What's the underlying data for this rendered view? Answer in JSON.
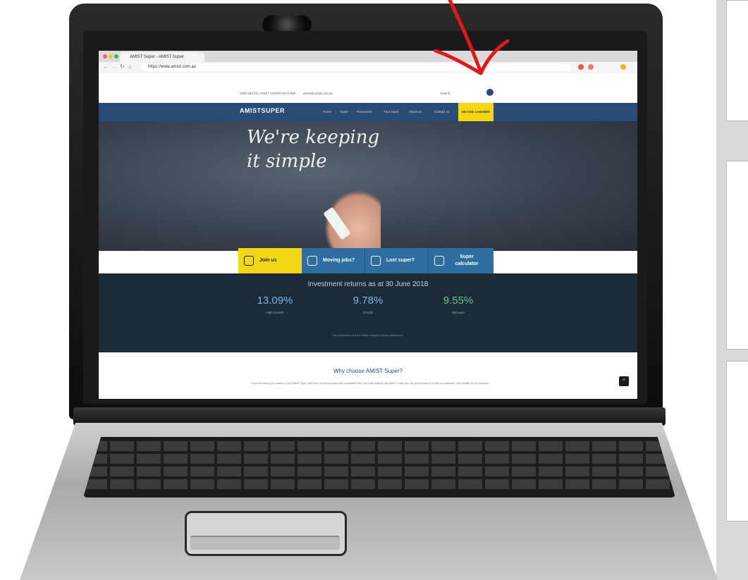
{
  "browser": {
    "tab_title": "AMIST Super - AMIST Super",
    "url": "https://www.amist.com.au"
  },
  "site": {
    "logo_text": "AMISTSUPER",
    "phone_text": "1300 653 911 AMIST SUPER HOTLINE",
    "email_text": "amist@amist.com.au",
    "search_placeholder": "Search",
    "nav_items": [
      "Home",
      "Super",
      "Resources",
      "Your super",
      "About us",
      "Contact us"
    ],
    "join_nav_label": "BECOME A MEMBER",
    "hero_headline_line1": "We're keeping",
    "hero_headline_line2": "it simple",
    "actions": [
      {
        "label": "Join us",
        "icon": "handshake-icon",
        "bg": "#f3d614",
        "fg": "#1c1c1c"
      },
      {
        "label": "Moving jobs?",
        "icon": "arrows-icon",
        "bg": "#2d6ea3",
        "fg": "#ffffff"
      },
      {
        "label": "Lost super?",
        "icon": "search-icon",
        "bg": "#2d6ea3",
        "fg": "#ffffff"
      },
      {
        "label": "Super calculator",
        "icon": "calculator-icon",
        "bg": "#2d6ea3",
        "fg": "#ffffff"
      }
    ],
    "returns_title": "Investment returns as at 30 June 2018",
    "returns": [
      {
        "value": "13.09%",
        "label": "High Growth",
        "color": "#6fb8e6"
      },
      {
        "value": "9.78%",
        "label": "Growth",
        "color": "#6fb8e6"
      },
      {
        "value": "9.55%",
        "label": "MySuper",
        "color": "#5fc88c"
      }
    ],
    "disclaimer": "Past performance is not a reliable indicator of future performance.",
    "why_title": "Why choose AMIST Super?",
    "why_body": "There are many good reasons to join AMIST Super other than our strong returns and competitive fees. We invite anybody with AMIST Super who has joined before to review our insurance, and benefits for our members.",
    "scroll_top_label": "⌃"
  },
  "colors": {
    "navy": "#2a4a78",
    "yellow": "#f3d614",
    "dark_band": "#1c2a39",
    "arrow_red": "#e01818"
  }
}
